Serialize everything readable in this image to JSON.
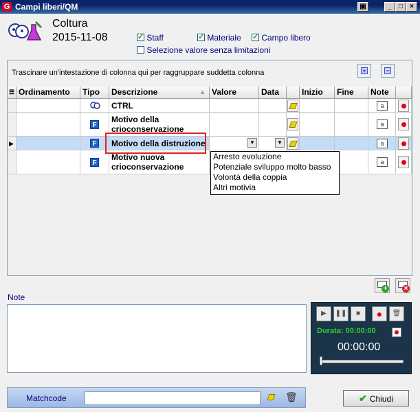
{
  "window": {
    "title": "Campi liberi/QM"
  },
  "header": {
    "title": "Coltura",
    "date": "2015-11-08",
    "checks": [
      {
        "label": "Staff",
        "checked": true
      },
      {
        "label": "Materiale",
        "checked": true
      },
      {
        "label": "Campo libero",
        "checked": true
      },
      {
        "label": "Selezione valore senza limitazioni",
        "checked": false
      }
    ]
  },
  "grid": {
    "group_hint": "Trascinare un'intestazione di colonna qui per raggruppare suddetta colonna",
    "columns": [
      "Ordinamento",
      "Tipo",
      "Descrizione",
      "Valore",
      "Data",
      "Inizio",
      "Fine",
      "Note"
    ],
    "rows": [
      {
        "tipo_icon": "staff-icon",
        "descrizione": "CTRL"
      },
      {
        "tipo_icon": "f-icon",
        "tipo_label": "F",
        "descrizione": "Motivo della crioconservazione"
      },
      {
        "tipo_icon": "f-icon",
        "tipo_label": "F",
        "descrizione": "Motivo della distruzione",
        "selected": true
      },
      {
        "tipo_icon": "f-icon",
        "tipo_label": "F",
        "descrizione": "Motivo nuova crioconservazione"
      }
    ],
    "note_icon_label": "a"
  },
  "dropdown": {
    "options": [
      "Arresto evoluzione",
      "Potenziale sviluppo molto basso",
      "Volontà della coppia",
      "Altri motivia"
    ]
  },
  "notes": {
    "label": "Note"
  },
  "player": {
    "duration_label": "Durata: 00:00:00",
    "time": "00:00:00"
  },
  "footer": {
    "matchcode_label": "Matchcode",
    "close_label": "Chiudi"
  },
  "colors": {
    "titlebar": "#0a246a",
    "selected_row": "#c5dcf7",
    "player_bg": "#1c3449",
    "highlight_box": "#e02020"
  }
}
